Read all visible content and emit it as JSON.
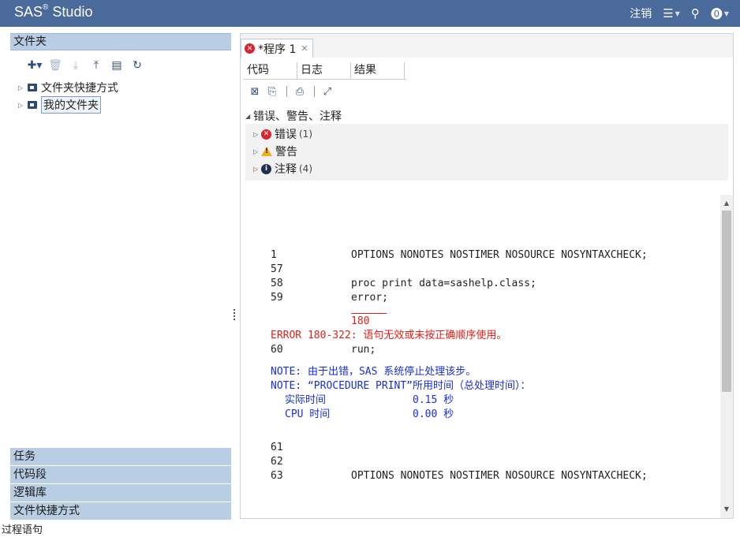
{
  "app": {
    "brand": "SAS",
    "brand_mark": "®",
    "brand_product": "Studio",
    "logout": "注销"
  },
  "left": {
    "folders_header": "文件夹",
    "tree": [
      {
        "label": "文件夹快捷方式",
        "selected": false
      },
      {
        "label": "我的文件夹",
        "selected": true
      }
    ],
    "sections": [
      "任务",
      "代码段",
      "逻辑库",
      "文件快捷方式"
    ]
  },
  "editor": {
    "tab_title": "*程序 1",
    "subtabs": [
      "代码",
      "日志",
      "结果"
    ],
    "active_subtab": "日志",
    "summary_header": "错误、警告、注释",
    "summary": [
      {
        "label": "错误",
        "count": "(1)",
        "kind": "error"
      },
      {
        "label": "警告",
        "count": "",
        "kind": "warning"
      },
      {
        "label": "注释",
        "count": "(4)",
        "kind": "note"
      }
    ],
    "log": {
      "l1_num": "1",
      "l1_code": "OPTIONS NONOTES NOSTIMER NOSOURCE NOSYNTAXCHECK;",
      "l57_num": "57",
      "l58_num": "58",
      "l58_code": "proc print data=sashelp.class;",
      "l59_num": "59",
      "l59_code": "error;",
      "err_code": "180",
      "err_msg": "ERROR 180-322: 语句无效或未按正确顺序使用。",
      "l60_num": "60",
      "l60_code": "run;",
      "note1": "NOTE: 由于出错，SAS 系统停止处理该步。",
      "note2": "NOTE: “PROCEDURE PRINT”所用时间（总处理时间）：",
      "real_label": "实际时间",
      "real_value": "0.15 秒",
      "cpu_label": "CPU 时间",
      "cpu_value": "0.00 秒",
      "l61_num": "61",
      "l62_num": "62",
      "l63_num": "63",
      "l63_code": "OPTIONS NONOTES NOSTIMER NOSOURCE NOSYNTAXCHECK;"
    }
  },
  "status": "过程语句"
}
